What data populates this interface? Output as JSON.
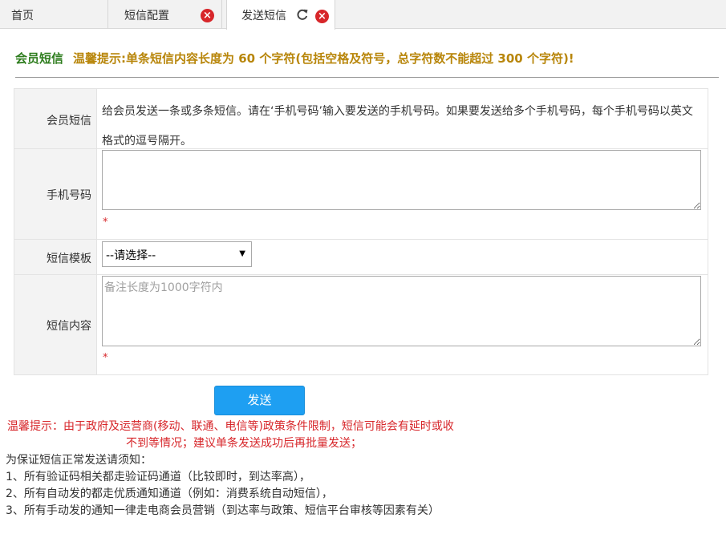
{
  "tabs": {
    "home": "首页",
    "config": "短信配置",
    "send": "发送短信"
  },
  "header": {
    "title": "会员短信",
    "tip": "温馨提示:单条短信内容长度为 60 个字符(包括空格及符号，总字符数不能超过 300 个字符)!"
  },
  "form": {
    "member_label": "会员短信",
    "member_desc": "给会员发送一条或多条短信。请在‘手机号码’输入要发送的手机号码。如果要发送给多个手机号码，每个手机号码以英文格式的逗号隔开。",
    "phone_label": "手机号码",
    "phone_value": "",
    "required_mark": "*",
    "template_label": "短信模板",
    "template_selected": "--请选择--",
    "content_label": "短信内容",
    "content_placeholder": "备注长度为1000字符内",
    "content_value": ""
  },
  "send_button": "发送",
  "warning": {
    "line1": "温馨提示：由于政府及运营商(移动、联通、电信等)政策条件限制，短信可能会有延时或收",
    "line2": "不到等情况；建议单条发送成功后再批量发送；"
  },
  "notes": {
    "title": "为保证短信正常发送请须知：",
    "items": [
      "1、所有验证码相关都走验证码通道（比较即时，到达率高），",
      "2、所有自动发的都走优质通知通道（例如：消费系统自动短信），",
      "3、所有手动发的通知一律走电商会员营销（到达率与政策、短信平台审核等因素有关）"
    ]
  },
  "colors": {
    "accent_green": "#2e7d1e",
    "tip_gold": "#b8860b",
    "warning_red": "#d7262a",
    "button_blue": "#1e9ff2"
  },
  "icons": {
    "close": "close-icon",
    "refresh": "refresh-icon"
  }
}
